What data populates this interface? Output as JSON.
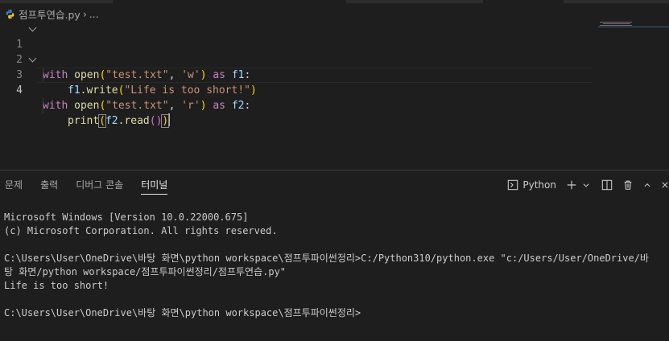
{
  "breadcrumb": {
    "file": "점프투연습.py",
    "rest": "..."
  },
  "editor": {
    "lines": [
      {
        "num": "1"
      },
      {
        "num": "2"
      },
      {
        "num": "3"
      },
      {
        "num": "4"
      }
    ],
    "tokens": {
      "with": "with",
      "open": "open",
      "as": "as",
      "f1": "f1",
      "f2": "f2",
      "write": "write",
      "read": "read",
      "print": "print",
      "filename": "\"test.txt\"",
      "mode_w": "'w'",
      "mode_r": "'r'",
      "message": "\"Life is too short!\""
    }
  },
  "panel": {
    "tabs": [
      "문제",
      "출력",
      "디버그 콘솔",
      "터미널"
    ],
    "active_tab": "터미널",
    "terminal_label": "Python"
  },
  "terminal": {
    "lines": [
      "Microsoft Windows [Version 10.0.22000.675]",
      "(c) Microsoft Corporation. All rights reserved.",
      "",
      "C:\\Users\\User\\OneDrive\\바탕 화면\\python workspace\\점프투파이썬정리>C:/Python310/python.exe \"c:/Users/User/OneDrive/바",
      "탕 화면/python workspace/점프투파이썬정리/점프투연습.py\"",
      "Life is too short!",
      "",
      "C:\\Users\\User\\OneDrive\\바탕 화면\\python workspace\\점프투파이썬정리>"
    ]
  },
  "colors": {
    "background": "#1e1e1e",
    "keyword": "#c586c0",
    "function": "#dcdcaa",
    "variable": "#9cdcfe",
    "string": "#ce9178"
  },
  "icons": [
    "python-file-icon",
    "terminal-icon",
    "plus-icon",
    "chevron-down-icon",
    "split-icon",
    "trash-icon",
    "chevron-up-icon",
    "close-icon"
  ]
}
